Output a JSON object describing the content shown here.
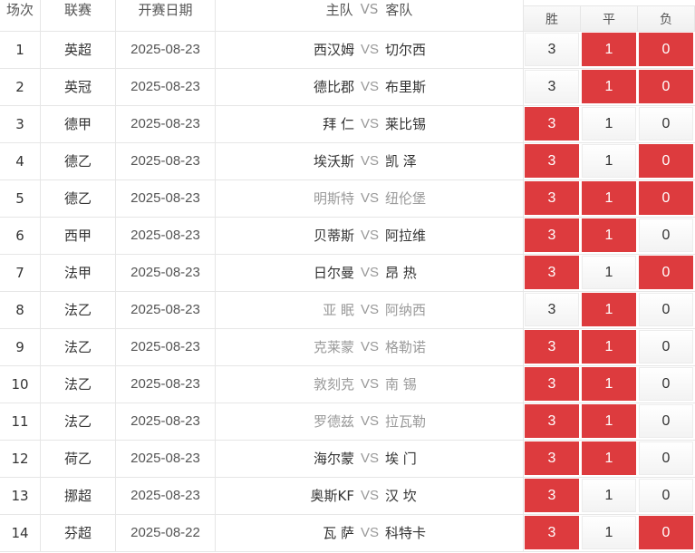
{
  "header": {
    "no": "场次",
    "league": "联赛",
    "date": "开赛日期",
    "home": "主队",
    "vs": "VS",
    "away": "客队",
    "win": "胜",
    "draw": "平",
    "lose": "负"
  },
  "rows": [
    {
      "no": "1",
      "league": "英超",
      "date": "2025-08-23",
      "home": "西汉姆",
      "away": "切尔西",
      "win": "3",
      "draw": "1",
      "lose": "0",
      "sel": [
        false,
        true,
        true
      ],
      "muted": false
    },
    {
      "no": "2",
      "league": "英冠",
      "date": "2025-08-23",
      "home": "德比郡",
      "away": "布里斯",
      "win": "3",
      "draw": "1",
      "lose": "0",
      "sel": [
        false,
        true,
        true
      ],
      "muted": false
    },
    {
      "no": "3",
      "league": "德甲",
      "date": "2025-08-23",
      "home": "拜 仁",
      "away": "莱比锡",
      "win": "3",
      "draw": "1",
      "lose": "0",
      "sel": [
        true,
        false,
        false
      ],
      "muted": false
    },
    {
      "no": "4",
      "league": "德乙",
      "date": "2025-08-23",
      "home": "埃沃斯",
      "away": "凯 泽",
      "win": "3",
      "draw": "1",
      "lose": "0",
      "sel": [
        true,
        false,
        true
      ],
      "muted": false
    },
    {
      "no": "5",
      "league": "德乙",
      "date": "2025-08-23",
      "home": "明斯特",
      "away": "纽伦堡",
      "win": "3",
      "draw": "1",
      "lose": "0",
      "sel": [
        true,
        true,
        true
      ],
      "muted": true
    },
    {
      "no": "6",
      "league": "西甲",
      "date": "2025-08-23",
      "home": "贝蒂斯",
      "away": "阿拉维",
      "win": "3",
      "draw": "1",
      "lose": "0",
      "sel": [
        true,
        true,
        false
      ],
      "muted": false
    },
    {
      "no": "7",
      "league": "法甲",
      "date": "2025-08-23",
      "home": "日尔曼",
      "away": "昂 热",
      "win": "3",
      "draw": "1",
      "lose": "0",
      "sel": [
        true,
        false,
        true
      ],
      "muted": false
    },
    {
      "no": "8",
      "league": "法乙",
      "date": "2025-08-23",
      "home": "亚 眠",
      "away": "阿纳西",
      "win": "3",
      "draw": "1",
      "lose": "0",
      "sel": [
        false,
        true,
        false
      ],
      "muted": true
    },
    {
      "no": "9",
      "league": "法乙",
      "date": "2025-08-23",
      "home": "克莱蒙",
      "away": "格勒诺",
      "win": "3",
      "draw": "1",
      "lose": "0",
      "sel": [
        true,
        true,
        false
      ],
      "muted": true
    },
    {
      "no": "10",
      "league": "法乙",
      "date": "2025-08-23",
      "home": "敦刻克",
      "away": "南 锡",
      "win": "3",
      "draw": "1",
      "lose": "0",
      "sel": [
        true,
        true,
        false
      ],
      "muted": true
    },
    {
      "no": "11",
      "league": "法乙",
      "date": "2025-08-23",
      "home": "罗德兹",
      "away": "拉瓦勒",
      "win": "3",
      "draw": "1",
      "lose": "0",
      "sel": [
        true,
        true,
        false
      ],
      "muted": true
    },
    {
      "no": "12",
      "league": "荷乙",
      "date": "2025-08-23",
      "home": "海尔蒙",
      "away": "埃 门",
      "win": "3",
      "draw": "1",
      "lose": "0",
      "sel": [
        true,
        true,
        false
      ],
      "muted": false
    },
    {
      "no": "13",
      "league": "挪超",
      "date": "2025-08-23",
      "home": "奥斯KF",
      "away": "汉 坎",
      "win": "3",
      "draw": "1",
      "lose": "0",
      "sel": [
        true,
        false,
        false
      ],
      "muted": false
    },
    {
      "no": "14",
      "league": "芬超",
      "date": "2025-08-22",
      "home": "瓦 萨",
      "away": "科特卡",
      "win": "3",
      "draw": "1",
      "lose": "0",
      "sel": [
        true,
        false,
        true
      ],
      "muted": false
    }
  ],
  "colors": {
    "selected": "#dd3b3e",
    "grid": "#e6e6e6",
    "muted": "#9a9a9a"
  }
}
